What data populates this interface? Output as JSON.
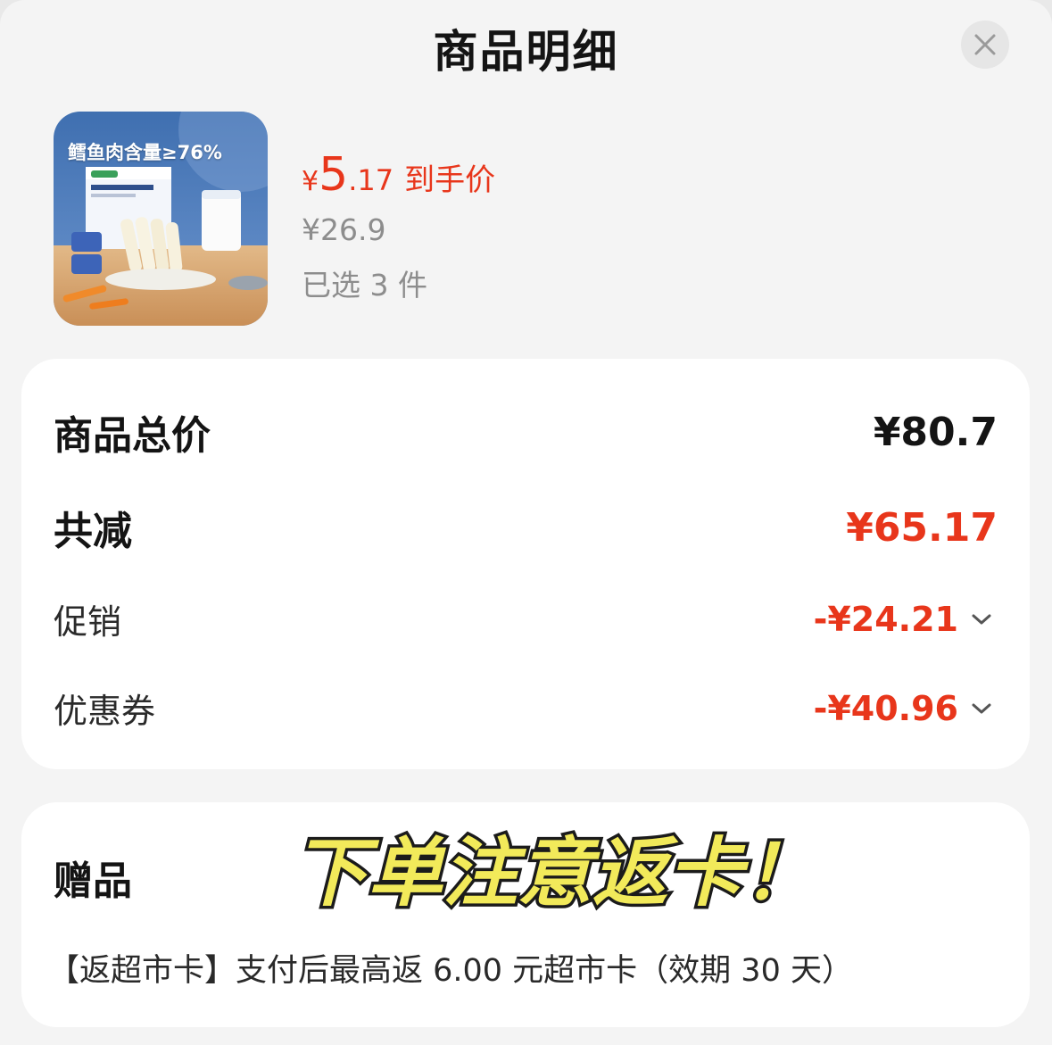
{
  "header": {
    "title": "商品明细",
    "close_icon": "close-icon"
  },
  "product": {
    "image_caption": "鳕鱼肉含量≥76%",
    "final_price": {
      "currency": "¥",
      "integer": "5",
      "decimal": ".17",
      "label": "到手价"
    },
    "original_price": "¥26.9",
    "selected_count": "已选 3 件"
  },
  "summary": {
    "total_label": "商品总价",
    "total_value": "¥80.7",
    "reduction_label": "共减",
    "reduction_value": "¥65.17",
    "promotion_label": "促销",
    "promotion_value": "-¥24.21",
    "coupon_label": "优惠券",
    "coupon_value": "-¥40.96"
  },
  "gift": {
    "title": "赠品",
    "banner_text": "下单注意返卡！",
    "description": "【返超市卡】支付后最高返 6.00 元超市卡（效期 30 天）"
  },
  "colors": {
    "accent_red": "#e8361b",
    "banner_yellow": "#f2ea5a",
    "background": "#f4f4f4"
  }
}
